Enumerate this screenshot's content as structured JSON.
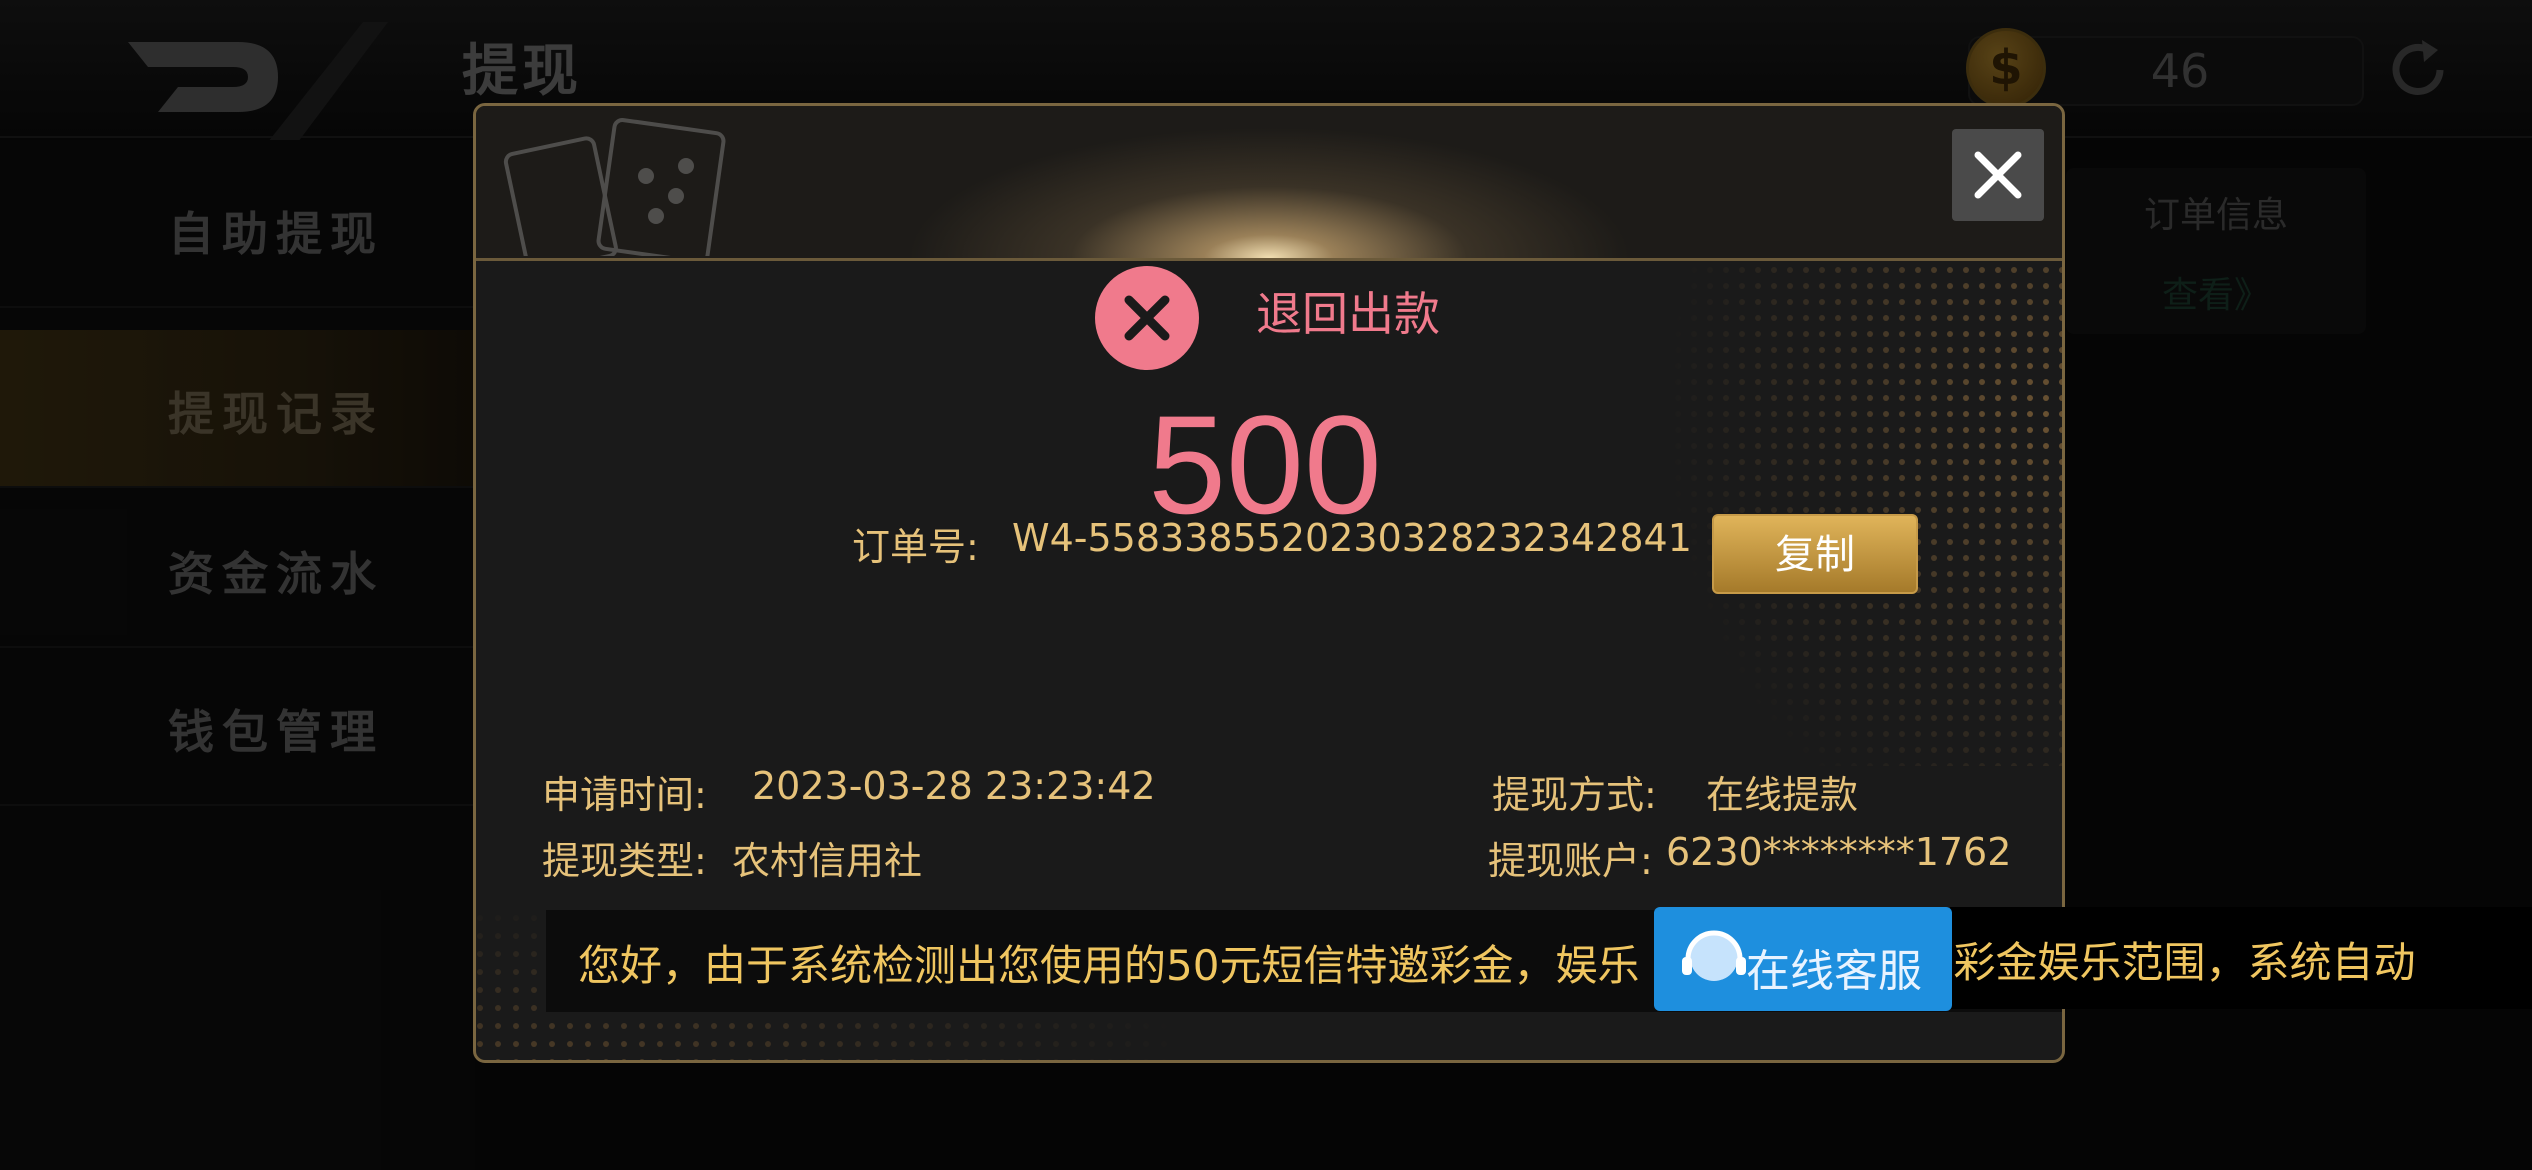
{
  "header": {
    "title": "提现",
    "balance": "46",
    "coin_symbol": "$"
  },
  "sidebar": {
    "items": [
      {
        "label": "自助提现"
      },
      {
        "label": "提现记录"
      },
      {
        "label": "资金流水"
      },
      {
        "label": "钱包管理"
      }
    ]
  },
  "order_panel": {
    "label": "订单信息",
    "link": "查看》"
  },
  "modal": {
    "status": "退回出款",
    "amount": "500",
    "order_label": "订单号:",
    "order_number": "W4-558338552023032823234284​1",
    "copy_label": "复制",
    "apply_time_label": "申请时间:",
    "apply_time": "2023-03-28 23:23:42",
    "method_label": "提现方式:",
    "method": "在线提款",
    "type_label": "提现类型:",
    "type": "农村信用社",
    "account_label": "提现账户:",
    "account": "6230********1762",
    "notice": "您好，由于系统检测出您使用的50元短信特邀彩金，娱乐【百家乐】，超出彩金娱乐范围，系统自动"
  },
  "support": {
    "label": "在线客服"
  },
  "colors": {
    "accent_gold": "#e6c27a",
    "status_pink": "#f07a8c",
    "support_blue": "#1e8fde"
  }
}
